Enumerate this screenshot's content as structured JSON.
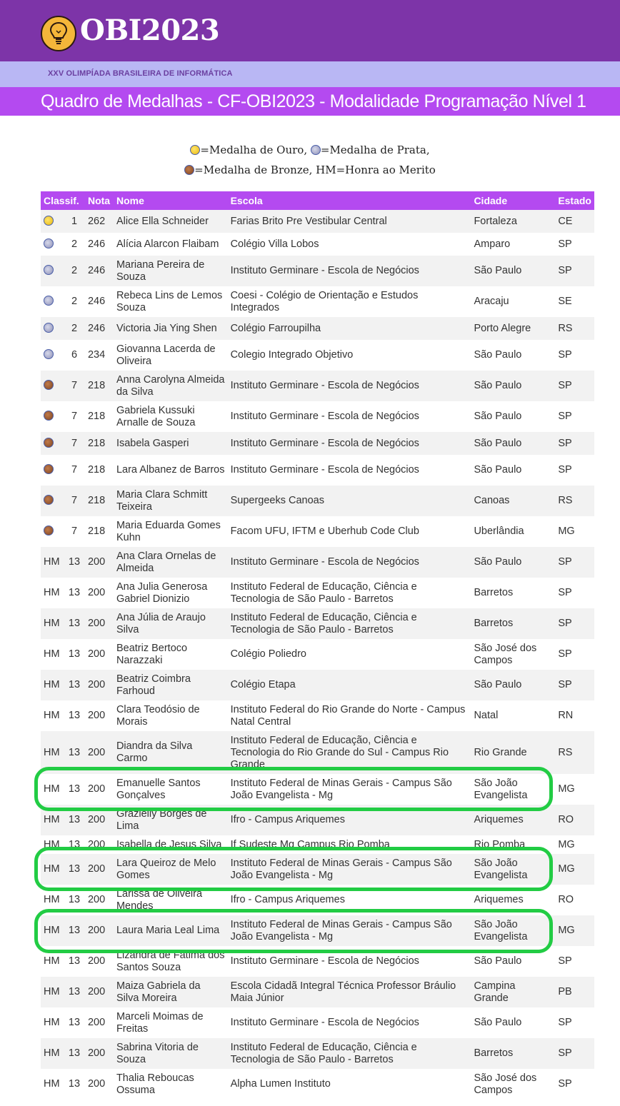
{
  "header": {
    "logo_text": "OBI2023",
    "subtitle": "XXV OLIMPÍADA BRASILEIRA DE INFORMÁTICA",
    "page_title": "Quadro de Medalhas - CF-OBI2023 - Modalidade Programação Nível 1"
  },
  "legend": {
    "gold": "=Medalha de Ouro,",
    "silver": "=Medalha de Prata,",
    "bronze": "=Medalha de Bronze, HM=Honra ao Merito"
  },
  "table": {
    "columns": [
      "Classif.",
      "Nota",
      "Nome",
      "Escola",
      "Cidade",
      "Estado"
    ],
    "rows": [
      {
        "medal": "gold",
        "hm": "",
        "rank": "1",
        "nota": "262",
        "nome": "Alice Ella Schneider",
        "escola": "Farias Brito Pre Vestibular Central",
        "cidade": "Fortaleza",
        "estado": "CE"
      },
      {
        "medal": "silver",
        "hm": "",
        "rank": "2",
        "nota": "246",
        "nome": "Alícia Alarcon Flaibam",
        "escola": "Colégio Villa Lobos",
        "cidade": "Amparo",
        "estado": "SP"
      },
      {
        "medal": "silver",
        "hm": "",
        "rank": "2",
        "nota": "246",
        "nome": "Mariana Pereira de Souza",
        "escola": "Instituto Germinare - Escola de Negócios",
        "cidade": "São Paulo",
        "estado": "SP"
      },
      {
        "medal": "silver",
        "hm": "",
        "rank": "2",
        "nota": "246",
        "nome": "Rebeca Lins de Lemos Souza",
        "escola": "Coesi - Colégio de Orientação e Estudos Integrados",
        "cidade": "Aracaju",
        "estado": "SE"
      },
      {
        "medal": "silver",
        "hm": "",
        "rank": "2",
        "nota": "246",
        "nome": "Victoria Jia Ying Shen",
        "escola": "Colégio Farroupilha",
        "cidade": "Porto Alegre",
        "estado": "RS"
      },
      {
        "medal": "silver",
        "hm": "",
        "rank": "6",
        "nota": "234",
        "nome": "Giovanna Lacerda de Oliveira",
        "escola": "Colegio Integrado Objetivo",
        "cidade": "São Paulo",
        "estado": "SP"
      },
      {
        "medal": "bronze",
        "hm": "",
        "rank": "7",
        "nota": "218",
        "nome": "Anna Carolyna Almeida da Silva",
        "escola": "Instituto Germinare - Escola de Negócios",
        "cidade": "São Paulo",
        "estado": "SP"
      },
      {
        "medal": "bronze",
        "hm": "",
        "rank": "7",
        "nota": "218",
        "nome": "Gabriela Kussuki Arnalle de Souza",
        "escola": "Instituto Germinare - Escola de Negócios",
        "cidade": "São Paulo",
        "estado": "SP"
      },
      {
        "medal": "bronze",
        "hm": "",
        "rank": "7",
        "nota": "218",
        "nome": "Isabela Gasperi",
        "escola": "Instituto Germinare - Escola de Negócios",
        "cidade": "São Paulo",
        "estado": "SP"
      },
      {
        "medal": "bronze",
        "hm": "",
        "rank": "7",
        "nota": "218",
        "nome": "Lara Albanez de Barros",
        "escola": "Instituto Germinare - Escola de Negócios",
        "cidade": "São Paulo",
        "estado": "SP"
      },
      {
        "medal": "bronze",
        "hm": "",
        "rank": "7",
        "nota": "218",
        "nome": "Maria Clara Schmitt Teixeira",
        "escola": "Supergeeks Canoas",
        "cidade": "Canoas",
        "estado": "RS"
      },
      {
        "medal": "bronze",
        "hm": "",
        "rank": "7",
        "nota": "218",
        "nome": "Maria Eduarda Gomes Kuhn",
        "escola": "Facom UFU, IFTM e Uberhub Code Club",
        "cidade": "Uberlândia",
        "estado": "MG"
      },
      {
        "medal": "",
        "hm": "HM",
        "rank": "13",
        "nota": "200",
        "nome": "Ana Clara Ornelas de Almeida",
        "escola": "Instituto Germinare - Escola de Negócios",
        "cidade": "São Paulo",
        "estado": "SP"
      },
      {
        "medal": "",
        "hm": "HM",
        "rank": "13",
        "nota": "200",
        "nome": "Ana Julia Generosa Gabriel Dionizio",
        "escola": "Instituto Federal de Educação, Ciência e Tecnologia de São Paulo - Barretos",
        "cidade": "Barretos",
        "estado": "SP"
      },
      {
        "medal": "",
        "hm": "HM",
        "rank": "13",
        "nota": "200",
        "nome": "Ana Júlia de Araujo Silva",
        "escola": "Instituto Federal de Educação, Ciência e Tecnologia de São Paulo - Barretos",
        "cidade": "Barretos",
        "estado": "SP"
      },
      {
        "medal": "",
        "hm": "HM",
        "rank": "13",
        "nota": "200",
        "nome": "Beatriz Bertoco Narazzaki",
        "escola": "Colégio Poliedro",
        "cidade": "São José dos Campos",
        "estado": "SP"
      },
      {
        "medal": "",
        "hm": "HM",
        "rank": "13",
        "nota": "200",
        "nome": "Beatriz Coimbra Farhoud",
        "escola": "Colégio Etapa",
        "cidade": "São Paulo",
        "estado": "SP"
      },
      {
        "medal": "",
        "hm": "HM",
        "rank": "13",
        "nota": "200",
        "nome": "Clara Teodósio de Morais",
        "escola": "Instituto Federal do Rio Grande do Norte - Campus Natal Central",
        "cidade": "Natal",
        "estado": "RN"
      },
      {
        "medal": "",
        "hm": "HM",
        "rank": "13",
        "nota": "200",
        "nome": "Diandra da Silva Carmo",
        "escola": "Instituto Federal de Educação, Ciência e Tecnologia do Rio Grande do Sul - Campus Rio Grande",
        "cidade": "Rio Grande",
        "estado": "RS"
      },
      {
        "medal": "",
        "hm": "HM",
        "rank": "13",
        "nota": "200",
        "nome": "Emanuelle Santos Gonçalves",
        "escola": "Instituto Federal de Minas Gerais - Campus São João Evangelista - Mg",
        "cidade": "São João Evangelista",
        "estado": "MG"
      },
      {
        "medal": "",
        "hm": "HM",
        "rank": "13",
        "nota": "200",
        "nome": "Grazielly Borges de Lima",
        "escola": "Ifro - Campus Ariquemes",
        "cidade": "Ariquemes",
        "estado": "RO"
      },
      {
        "medal": "",
        "hm": "HM",
        "rank": "13",
        "nota": "200",
        "nome": "Isabella de Jesus Silva",
        "escola": "If Sudeste Mg Campus Rio Pomba",
        "cidade": "Rio Pomba",
        "estado": "MG"
      },
      {
        "medal": "",
        "hm": "HM",
        "rank": "13",
        "nota": "200",
        "nome": "Lara Queiroz de Melo Gomes",
        "escola": "Instituto Federal de Minas Gerais - Campus São João Evangelista - Mg",
        "cidade": "São João Evangelista",
        "estado": "MG"
      },
      {
        "medal": "",
        "hm": "HM",
        "rank": "13",
        "nota": "200",
        "nome": "Larissa de Oliveira Mendes",
        "escola": "Ifro - Campus Ariquemes",
        "cidade": "Ariquemes",
        "estado": "RO"
      },
      {
        "medal": "",
        "hm": "HM",
        "rank": "13",
        "nota": "200",
        "nome": "Laura Maria Leal Lima",
        "escola": "Instituto Federal de Minas Gerais - Campus São João Evangelista - Mg",
        "cidade": "São João Evangelista",
        "estado": "MG"
      },
      {
        "medal": "",
        "hm": "HM",
        "rank": "13",
        "nota": "200",
        "nome": "Lizandra de Fatima dos Santos Souza",
        "escola": "Instituto Germinare - Escola de Negócios",
        "cidade": "São Paulo",
        "estado": "SP"
      },
      {
        "medal": "",
        "hm": "HM",
        "rank": "13",
        "nota": "200",
        "nome": "Maiza Gabriela da Silva Moreira",
        "escola": "Escola Cidadã Integral Técnica Professor Bráulio Maia Júnior",
        "cidade": "Campina Grande",
        "estado": "PB"
      },
      {
        "medal": "",
        "hm": "HM",
        "rank": "13",
        "nota": "200",
        "nome": "Marceli Moimas de Freitas",
        "escola": "Instituto Germinare - Escola de Negócios",
        "cidade": "São Paulo",
        "estado": "SP"
      },
      {
        "medal": "",
        "hm": "HM",
        "rank": "13",
        "nota": "200",
        "nome": "Sabrina Vitoria de Souza",
        "escola": "Instituto Federal de Educação, Ciência e Tecnologia de São Paulo - Barretos",
        "cidade": "Barretos",
        "estado": "SP"
      },
      {
        "medal": "",
        "hm": "HM",
        "rank": "13",
        "nota": "200",
        "nome": "Thalia Reboucas Ossuma",
        "escola": "Alpha Lumen Instituto",
        "cidade": "São José dos Campos",
        "estado": "SP"
      }
    ]
  }
}
